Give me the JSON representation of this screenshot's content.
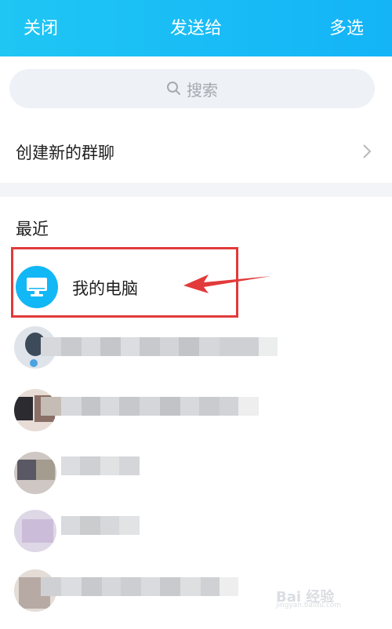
{
  "header": {
    "close": "关闭",
    "title": "发送给",
    "multiselect": "多选"
  },
  "search": {
    "placeholder": "搜索"
  },
  "create_group": {
    "label": "创建新的群聊"
  },
  "recent": {
    "section_title": "最近",
    "items": [
      {
        "label": "我的电脑",
        "icon": "computer-icon"
      }
    ]
  },
  "colors": {
    "header": "#14b4f7",
    "accent": "#12b7f5",
    "highlight": "#e23a3a"
  },
  "watermark": {
    "text": "Bai 经验",
    "url": "jingyan.baidu.com"
  }
}
